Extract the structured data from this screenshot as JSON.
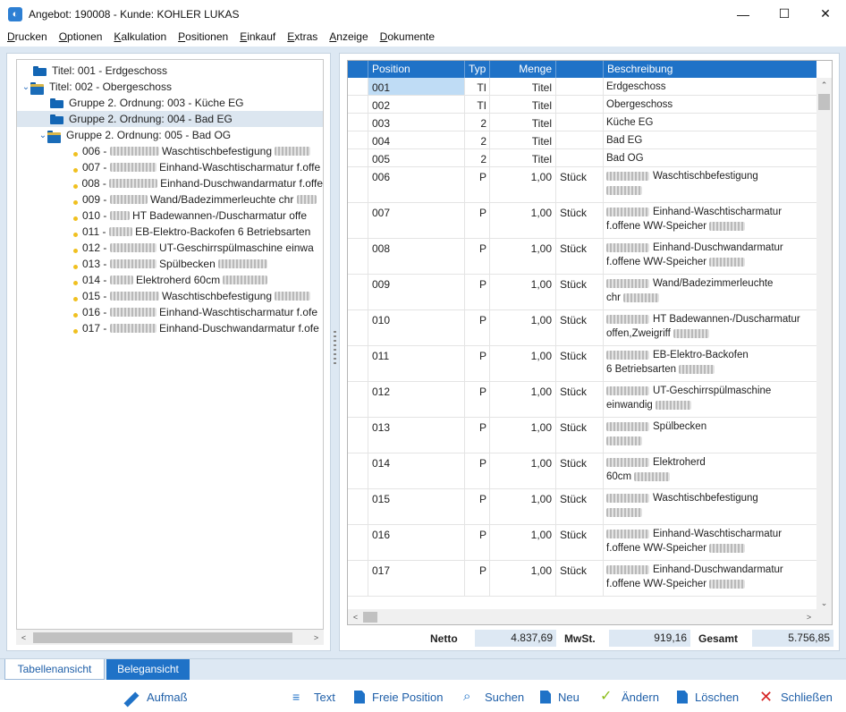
{
  "window": {
    "title": "Angebot: 190008 - Kunde: KOHLER LUKAS",
    "minimize_glyph": "—",
    "maximize_glyph": "☐",
    "close_glyph": "✕"
  },
  "menu": [
    {
      "u": "D",
      "rest": "rucken"
    },
    {
      "u": "O",
      "rest": "ptionen"
    },
    {
      "u": "K",
      "rest": "alkulation"
    },
    {
      "u": "P",
      "rest": "ositionen"
    },
    {
      "u": "E",
      "rest": "inkauf"
    },
    {
      "u": "E",
      "rest": "xtras"
    },
    {
      "u": "A",
      "rest": "nzeige"
    },
    {
      "u": "D",
      "rest": "okumente"
    }
  ],
  "tree": {
    "items": [
      {
        "label": "Titel: 001 - Erdgeschoss"
      },
      {
        "label": "Titel: 002 - Obergeschoss"
      },
      {
        "label": "Gruppe 2. Ordnung: 003 - Küche EG"
      },
      {
        "label": "Gruppe 2. Ordnung: 004 - Bad EG"
      },
      {
        "label": "Gruppe 2. Ordnung: 005 - Bad OG"
      },
      {
        "label_a": "006 -",
        "label_b": "Waschtischbefestigung"
      },
      {
        "label_a": "007 -",
        "label_b": "Einhand-Waschtischarmatur f.offe"
      },
      {
        "label_a": "008 -",
        "label_b": "Einhand-Duschwandarmatur f.offe"
      },
      {
        "label_a": "009 -",
        "label_b": "Wand/Badezimmerleuchte chr"
      },
      {
        "label_a": "010 -",
        "label_b": "HT Badewannen-/Duscharmatur offe"
      },
      {
        "label_a": "011 -",
        "label_b": "EB-Elektro-Backofen 6 Betriebsarten"
      },
      {
        "label_a": "012 -",
        "label_b": "UT-Geschirrspülmaschine einwa"
      },
      {
        "label_a": "013 -",
        "label_b": "Spülbecken"
      },
      {
        "label_a": "014 -",
        "label_b": "Elektroherd 60cm"
      },
      {
        "label_a": "015 -",
        "label_b": "Waschtischbefestigung"
      },
      {
        "label_a": "016 -",
        "label_b": "Einhand-Waschtischarmatur f.ofe"
      },
      {
        "label_a": "017 -",
        "label_b": "Einhand-Duschwandarmatur f.ofe"
      }
    ]
  },
  "grid": {
    "headers": {
      "position": "Position",
      "typ": "Typ",
      "menge": "Menge",
      "beschreibung": "Beschreibung"
    },
    "rows": [
      {
        "pos": "001",
        "typ": "TI",
        "menge": "Titel",
        "einheit": "",
        "desc1": "Erdgeschoss",
        "desc2": ""
      },
      {
        "pos": "002",
        "typ": "TI",
        "menge": "Titel",
        "einheit": "",
        "desc1": "Obergeschoss",
        "desc2": ""
      },
      {
        "pos": "003",
        "typ": "2",
        "menge": "Titel",
        "einheit": "",
        "desc1": "Küche EG",
        "desc2": ""
      },
      {
        "pos": "004",
        "typ": "2",
        "menge": "Titel",
        "einheit": "",
        "desc1": "Bad EG",
        "desc2": ""
      },
      {
        "pos": "005",
        "typ": "2",
        "menge": "Titel",
        "einheit": "",
        "desc1": "Bad OG",
        "desc2": ""
      },
      {
        "pos": "006",
        "typ": "P",
        "menge": "1,00",
        "einheit": "Stück",
        "desc1": "Waschtischbefestigung",
        "desc2": ""
      },
      {
        "pos": "007",
        "typ": "P",
        "menge": "1,00",
        "einheit": "Stück",
        "desc1": "Einhand-Waschtischarmatur",
        "desc2": "f.offene WW-Speicher"
      },
      {
        "pos": "008",
        "typ": "P",
        "menge": "1,00",
        "einheit": "Stück",
        "desc1": "Einhand-Duschwandarmatur",
        "desc2": "f.offene WW-Speicher"
      },
      {
        "pos": "009",
        "typ": "P",
        "menge": "1,00",
        "einheit": "Stück",
        "desc1": "Wand/Badezimmerleuchte",
        "desc2": "chr"
      },
      {
        "pos": "010",
        "typ": "P",
        "menge": "1,00",
        "einheit": "Stück",
        "desc1": "HT Badewannen-/Duscharmatur",
        "desc2": "offen,Zweigriff"
      },
      {
        "pos": "011",
        "typ": "P",
        "menge": "1,00",
        "einheit": "Stück",
        "desc1": "EB-Elektro-Backofen",
        "desc2": "6 Betriebsarten"
      },
      {
        "pos": "012",
        "typ": "P",
        "menge": "1,00",
        "einheit": "Stück",
        "desc1": "UT-Geschirrspülmaschine",
        "desc2": "einwandig"
      },
      {
        "pos": "013",
        "typ": "P",
        "menge": "1,00",
        "einheit": "Stück",
        "desc1": "Spülbecken",
        "desc2": ""
      },
      {
        "pos": "014",
        "typ": "P",
        "menge": "1,00",
        "einheit": "Stück",
        "desc1": "Elektroherd",
        "desc2": "60cm"
      },
      {
        "pos": "015",
        "typ": "P",
        "menge": "1,00",
        "einheit": "Stück",
        "desc1": "Waschtischbefestigung",
        "desc2": ""
      },
      {
        "pos": "016",
        "typ": "P",
        "menge": "1,00",
        "einheit": "Stück",
        "desc1": "Einhand-Waschtischarmatur",
        "desc2": "f.offene WW-Speicher"
      },
      {
        "pos": "017",
        "typ": "P",
        "menge": "1,00",
        "einheit": "Stück",
        "desc1": "Einhand-Duschwandarmatur",
        "desc2": "f.offene WW-Speicher"
      }
    ]
  },
  "totals": {
    "netto_label": "Netto",
    "netto_value": "4.837,69",
    "mwst_label": "MwSt.",
    "mwst_value": "919,16",
    "gesamt_label": "Gesamt",
    "gesamt_value": "5.756,85"
  },
  "tabs": {
    "table_view": "Tabellenansicht",
    "doc_view": "Belegansicht"
  },
  "toolbar": {
    "aufmass": "Aufmaß",
    "text": "Text",
    "freie_position": "Freie Position",
    "suchen": "Suchen",
    "neu": "Neu",
    "aendern": "Ändern",
    "loeschen": "Löschen",
    "schliessen": "Schließen"
  },
  "colors": {
    "accent": "#1f72c7",
    "panel_bg": "#dde8f3",
    "selection": "#dce6f0"
  }
}
